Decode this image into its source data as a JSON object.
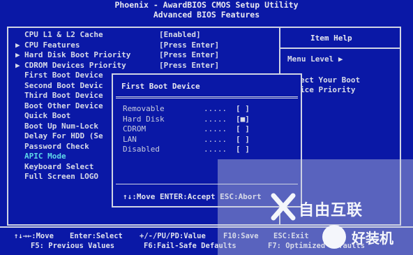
{
  "header": {
    "line1": "Phoenix - AwardBIOS CMOS Setup Utility",
    "line2": "Advanced BIOS Features"
  },
  "menu": {
    "items": [
      {
        "label": "CPU L1 & L2 Cache",
        "arrow": "",
        "value": "[Enabled]"
      },
      {
        "label": "CPU Features",
        "arrow": "▶",
        "value": "[Press Enter]"
      },
      {
        "label": "Hard Disk Boot Priority",
        "arrow": "▶",
        "value": "[Press Enter]"
      },
      {
        "label": "CDROM Devices Priority",
        "arrow": "▶",
        "value": "[Press Enter]"
      },
      {
        "label": "First Boot Device",
        "arrow": "",
        "value": ""
      },
      {
        "label": "Second Boot Devic",
        "arrow": "",
        "value": ""
      },
      {
        "label": "Third Boot Device",
        "arrow": "",
        "value": ""
      },
      {
        "label": "Boot Other Device",
        "arrow": "",
        "value": ""
      },
      {
        "label": "Quick Boot",
        "arrow": "",
        "value": ""
      },
      {
        "label": "Boot Up Num-Lock",
        "arrow": "",
        "value": ""
      },
      {
        "label": "Delay For HDD (Se",
        "arrow": "",
        "value": ""
      },
      {
        "label": "Password Check",
        "arrow": "",
        "value": ""
      },
      {
        "label": "APIC Mode",
        "arrow": "",
        "value": ""
      },
      {
        "label": "Keyboard Select",
        "arrow": "",
        "value": ""
      },
      {
        "label": "Full Screen LOGO",
        "arrow": "",
        "value": ""
      }
    ]
  },
  "help": {
    "title": "Item Help",
    "menu_level": "Menu Level   ▶",
    "line1": "ect Your Boot",
    "line2": "ice Priority"
  },
  "popup": {
    "title": "First Boot Device",
    "options": [
      {
        "label": "Removable",
        "dots": ".....",
        "box": "[ ]"
      },
      {
        "label": "Hard Disk",
        "dots": ".....",
        "box": "[■]"
      },
      {
        "label": "CDROM",
        "dots": ".....",
        "box": "[ ]"
      },
      {
        "label": "LAN",
        "dots": ".....",
        "box": "[ ]"
      },
      {
        "label": "Disabled",
        "dots": ".....",
        "box": "[ ]"
      }
    ],
    "footer": "↑↓:Move ENTER:Accept ESC:Abort"
  },
  "legend": {
    "row1": [
      "↑↓→←:Move",
      "Enter:Select",
      "+/-/PU/PD:Value",
      "F10:Save",
      "ESC:Exit"
    ],
    "row2": [
      "F5: Previous Values",
      "F6:Fail-Safe Defaults",
      "F7: Optimized Defaults"
    ]
  },
  "watermark": {
    "brand1": "自由互联",
    "brand2": "好装机"
  },
  "colors": {
    "background": "#0a18a6",
    "text": "#d8dbe8",
    "highlight": "#5ed8e8"
  }
}
